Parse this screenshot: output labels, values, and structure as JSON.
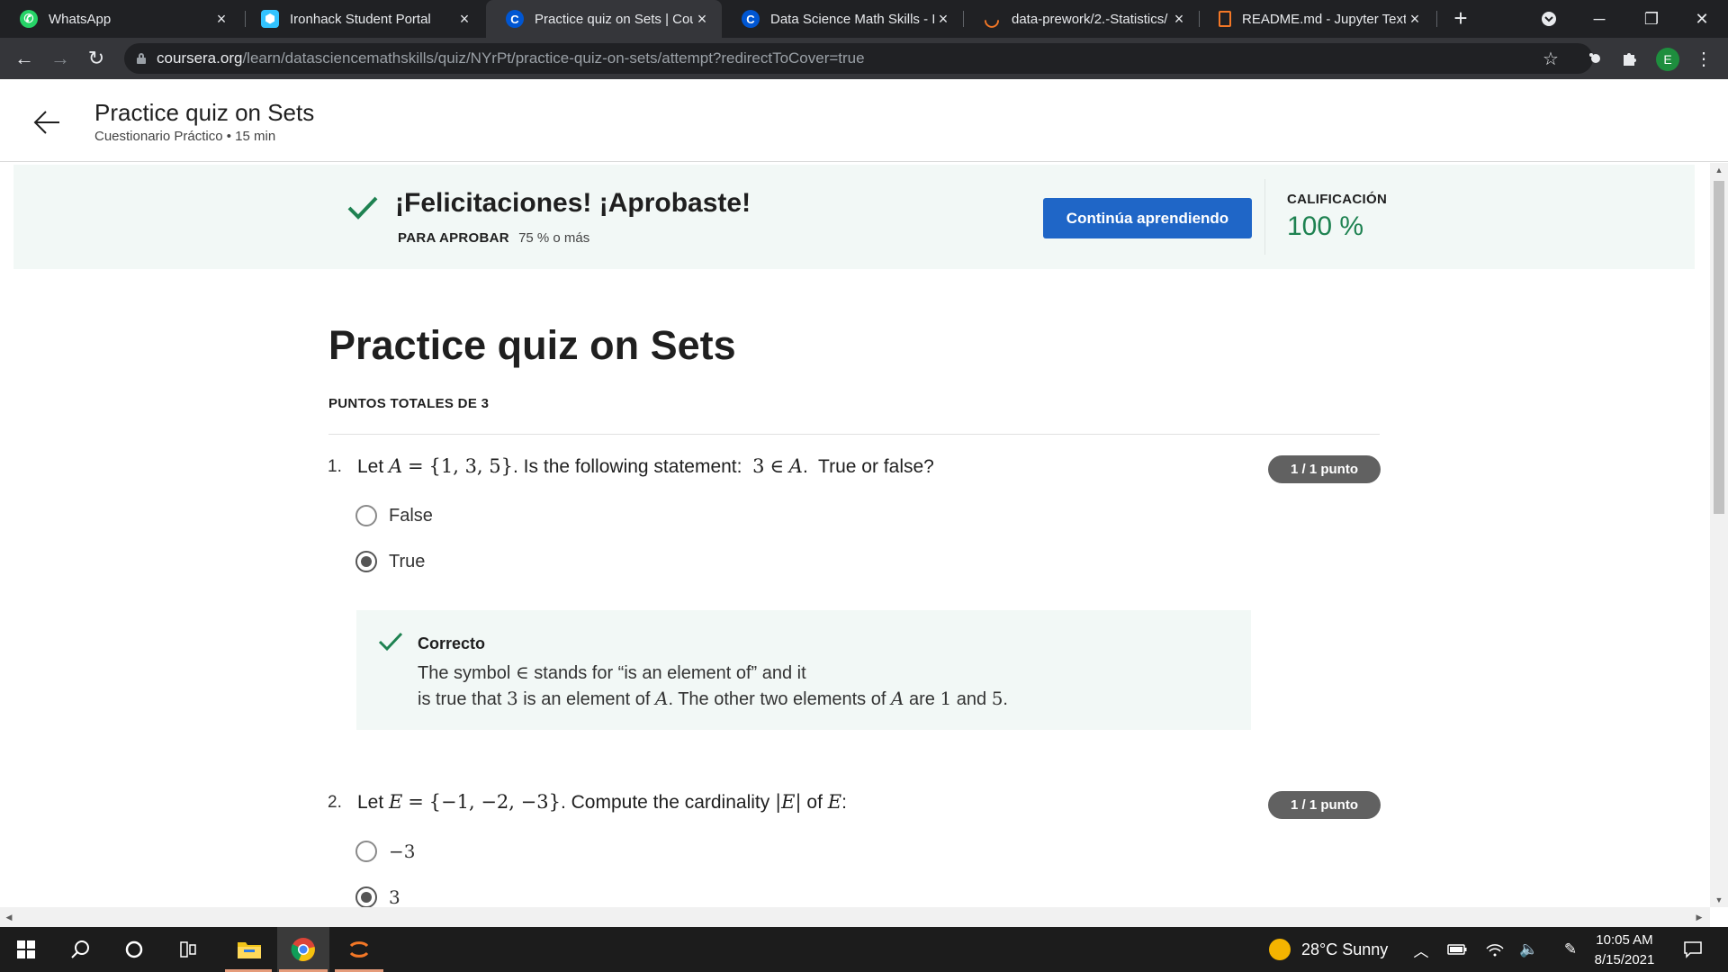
{
  "browser": {
    "tabs": [
      {
        "title": "WhatsApp",
        "icon": "whatsapp-icon",
        "active": false
      },
      {
        "title": "Ironhack Student Portal",
        "icon": "ironhack-icon",
        "active": false
      },
      {
        "title": "Practice quiz on Sets | Cour",
        "icon": "coursera-icon",
        "active": true
      },
      {
        "title": "Data Science Math Skills - Ir",
        "icon": "coursera-icon",
        "active": false
      },
      {
        "title": "data-prework/2.-Statistics/",
        "icon": "jupyter-icon",
        "active": false
      },
      {
        "title": "README.md - Jupyter Text E",
        "icon": "file-icon",
        "active": false
      }
    ],
    "url_host": "coursera.org",
    "url_path": "/learn/datasciencemathskills/quiz/NYrPt/practice-quiz-on-sets/attempt?redirectToCover=true",
    "profile_initial": "E"
  },
  "header": {
    "title": "Practice quiz on Sets",
    "subtitle": "Cuestionario Práctico • 15 min"
  },
  "banner": {
    "title": "¡Felicitaciones! ¡Aprobaste!",
    "pass_label": "PARA APROBAR",
    "pass_value": "75 % o más",
    "continue_label": "Continúa aprendiendo",
    "grade_label": "CALIFICACIÓN",
    "grade_value": "100 %"
  },
  "quiz": {
    "title": "Practice quiz on Sets",
    "total_points": "PUNTOS TOTALES DE 3",
    "q1": {
      "number": "1.",
      "badge": "1 / 1 punto",
      "options": [
        "False",
        "True"
      ],
      "selected_index": 1,
      "feedback_title": "Correcto"
    },
    "q2": {
      "number": "2.",
      "badge": "1 / 1 punto",
      "options": [
        "−3",
        "3"
      ],
      "selected_index": 1
    }
  },
  "taskbar": {
    "weather": "28°C  Sunny",
    "time": "10:05 AM",
    "date": "8/15/2021"
  },
  "colors": {
    "success_green": "#1e8251",
    "primary_button": "#1f66c7",
    "banner_bg": "#f2f8f6"
  }
}
